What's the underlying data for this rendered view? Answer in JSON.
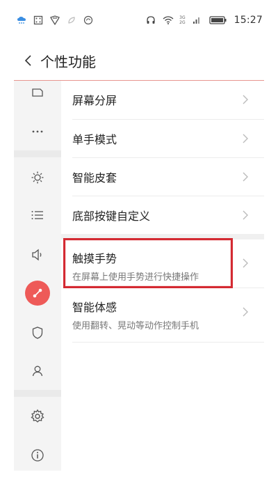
{
  "status_bar": {
    "net_top": "3G",
    "net_bottom": "2G",
    "time": "15:27"
  },
  "header": {
    "title": "个性功能"
  },
  "rail": {
    "items": [
      "tablet-icon",
      "more-icon",
      "brightness-icon",
      "list-icon",
      "speaker-icon",
      "personal-feature-icon",
      "shield-icon",
      "account-icon",
      "settings-icon",
      "info-icon"
    ],
    "active_color": "#ee5a58"
  },
  "list": {
    "items": [
      {
        "title": "屏幕分屏",
        "subtitle": ""
      },
      {
        "title": "单手模式",
        "subtitle": ""
      },
      {
        "title": "智能皮套",
        "subtitle": ""
      },
      {
        "title": "底部按键自定义",
        "subtitle": ""
      },
      {
        "title": "触摸手势",
        "subtitle": "在屏幕上使用手势进行快捷操作"
      },
      {
        "title": "智能体感",
        "subtitle": "使用翻转、晃动等动作控制手机"
      }
    ],
    "highlight_color": "#d42a32"
  },
  "colors": {
    "accent": "#ee5a58",
    "header_line": "#e7958f",
    "text_primary": "#222222",
    "text_secondary": "#777777"
  }
}
